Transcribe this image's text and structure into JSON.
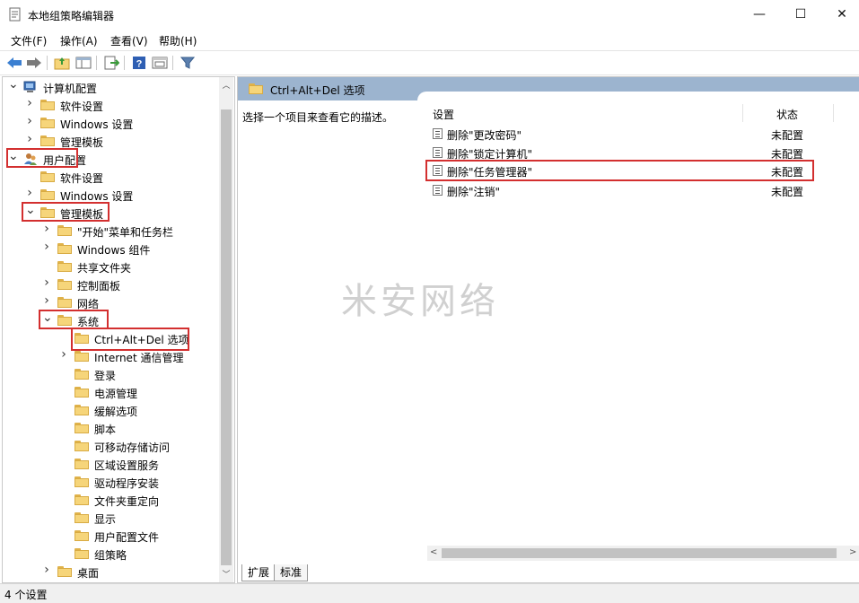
{
  "window": {
    "title": "本地组策略编辑器",
    "controls": [
      "—",
      "☐",
      "✕"
    ]
  },
  "menu": [
    "文件(F)",
    "操作(A)",
    "查看(V)",
    "帮助(H)"
  ],
  "tree": {
    "items": [
      {
        "label": "计算机配置"
      },
      {
        "label": "软件设置"
      },
      {
        "label": "Windows 设置"
      },
      {
        "label": "管理模板"
      },
      {
        "label": "用户配置"
      },
      {
        "label": "软件设置"
      },
      {
        "label": "Windows 设置"
      },
      {
        "label": "管理模板"
      },
      {
        "label": "\"开始\"菜单和任务栏"
      },
      {
        "label": "Windows 组件"
      },
      {
        "label": "共享文件夹"
      },
      {
        "label": "控制面板"
      },
      {
        "label": "网络"
      },
      {
        "label": "系统"
      },
      {
        "label": "Ctrl+Alt+Del 选项"
      },
      {
        "label": "Internet 通信管理"
      },
      {
        "label": "登录"
      },
      {
        "label": "电源管理"
      },
      {
        "label": "缓解选项"
      },
      {
        "label": "脚本"
      },
      {
        "label": "可移动存储访问"
      },
      {
        "label": "区域设置服务"
      },
      {
        "label": "驱动程序安装"
      },
      {
        "label": "文件夹重定向"
      },
      {
        "label": "显示"
      },
      {
        "label": "用户配置文件"
      },
      {
        "label": "组策略"
      },
      {
        "label": "桌面"
      }
    ]
  },
  "right": {
    "header": "Ctrl+Alt+Del 选项",
    "description": "选择一个项目来查看它的描述。",
    "columns": {
      "setting": "设置",
      "state": "状态"
    },
    "rows": [
      {
        "name": "删除\"更改密码\"",
        "state": "未配置"
      },
      {
        "name": "删除\"锁定计算机\"",
        "state": "未配置"
      },
      {
        "name": "删除\"任务管理器\"",
        "state": "未配置"
      },
      {
        "name": "删除\"注销\"",
        "state": "未配置"
      }
    ],
    "tabs": [
      "扩展",
      "标准"
    ]
  },
  "watermark": "米安网络",
  "status": "4 个设置",
  "colors": {
    "highlight": "#d32f2f",
    "header_band": "#9cb4cf",
    "folder": "#f6d57a"
  }
}
